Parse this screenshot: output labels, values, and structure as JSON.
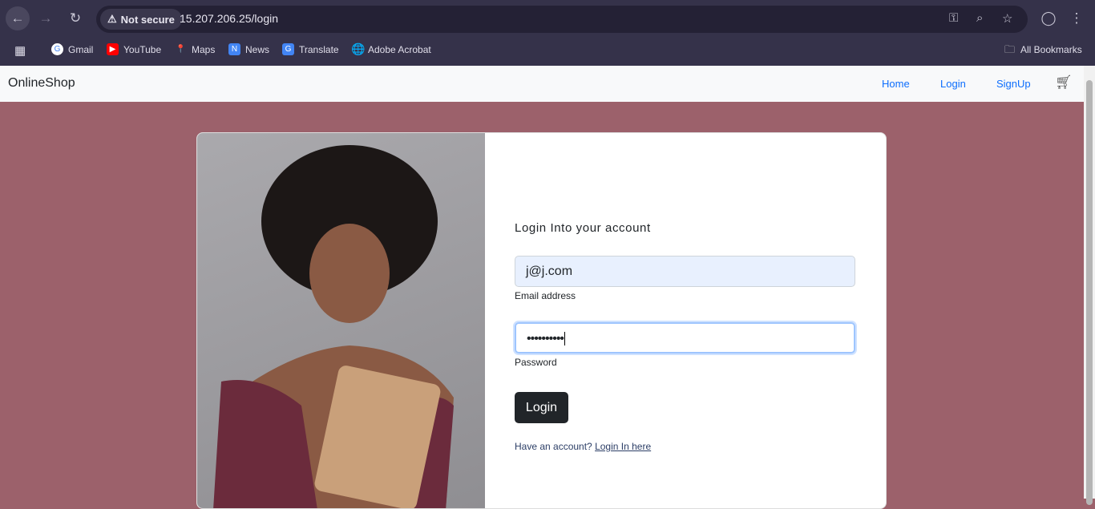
{
  "browser": {
    "security_label": "Not secure",
    "url": "15.207.206.25/login",
    "bookmarks": [
      "Gmail",
      "YouTube",
      "Maps",
      "News",
      "Translate",
      "Adobe Acrobat"
    ],
    "all_bookmarks": "All Bookmarks"
  },
  "navbar": {
    "brand": "OnlineShop",
    "links": [
      "Home",
      "Login",
      "SignUp"
    ],
    "cart_icon": "cart-icon"
  },
  "login": {
    "title": "Login Into your account",
    "email_value": "j@j.com",
    "email_label": "Email address",
    "password_value": "••••••••••",
    "password_label": "Password",
    "button": "Login",
    "footer_text": "Have an account?",
    "footer_link": "Login In here"
  },
  "colors": {
    "background": "#9c616b",
    "button": "#212529",
    "link": "#0d6efd"
  }
}
